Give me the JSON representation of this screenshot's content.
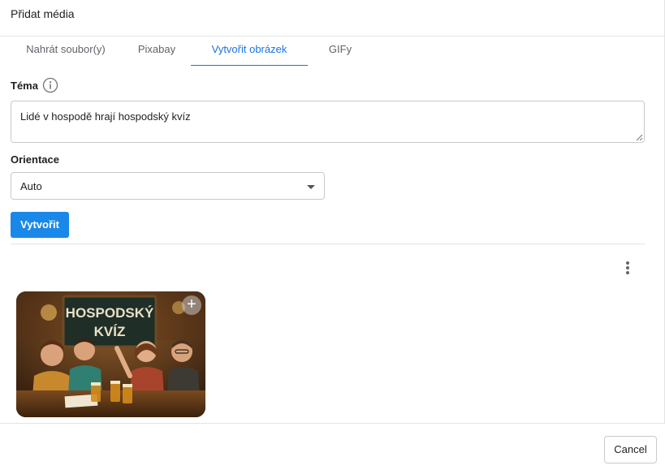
{
  "dialog": {
    "title": "Přidat média"
  },
  "tabs": [
    {
      "label": "Nahrát soubor(y)",
      "active": false
    },
    {
      "label": "Pixabay",
      "active": false
    },
    {
      "label": "Vytvořit obrázek",
      "active": true
    },
    {
      "label": "GIFy",
      "active": false
    }
  ],
  "form": {
    "topic_label": "Téma",
    "topic_value": "Lidé v hospodě hrají hospodský kvíz",
    "orientation_label": "Orientace",
    "orientation_value": "Auto",
    "create_label": "Vytvořit"
  },
  "results": {
    "image_sign_line1": "HOSPODSKÝ",
    "image_sign_line2": "KVÍZ",
    "add_icon": "+"
  },
  "footer": {
    "cancel_label": "Cancel"
  },
  "colors": {
    "accent": "#1a73e8",
    "button": "#1a88e8",
    "border": "#c9c9c9"
  },
  "icons": [
    "info-icon",
    "chevron-down-icon",
    "more-vertical-icon",
    "plus-icon"
  ]
}
